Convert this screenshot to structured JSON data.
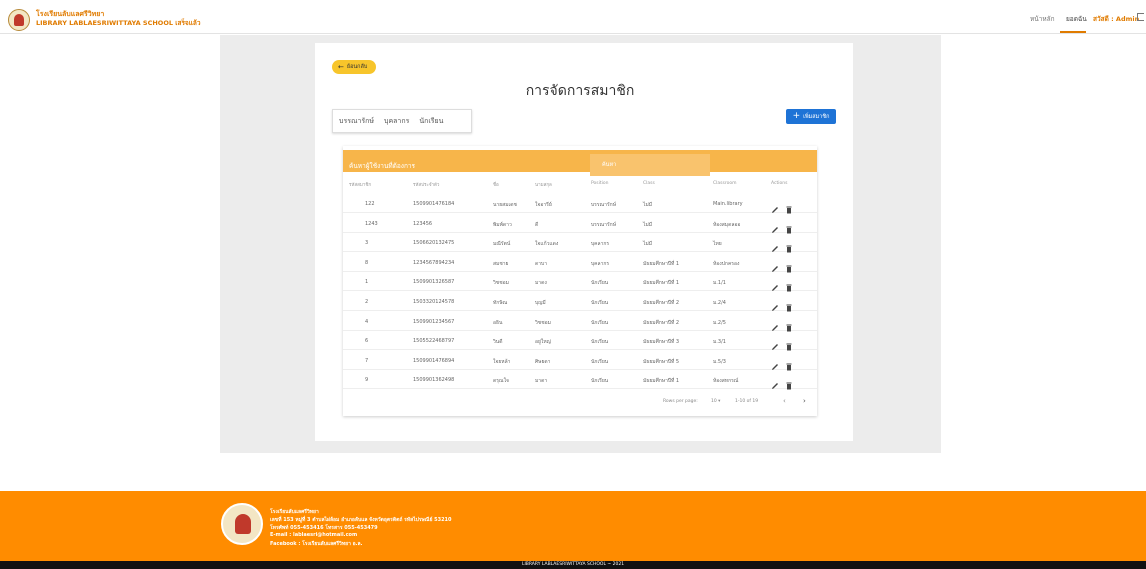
{
  "header": {
    "school_name": "โรงเรียนลับแลศรีวิทยา",
    "library_name": "LIBRARY LABLAESRIWITTAYA SCHOOL เสร็จแล้ว",
    "nav": [
      {
        "label": "หน้าหลัก"
      },
      {
        "label": "ยอดฉัน"
      },
      {
        "label": "สวัสดี : Admin"
      }
    ]
  },
  "page": {
    "back_label": "ย้อนกลับ",
    "title": "การจัดการสมาชิก",
    "tabs": [
      "บรรณารักษ์",
      "บุคลากร",
      "นักเรียน"
    ],
    "add_label": "เพิ่มสมาชิก"
  },
  "table": {
    "search_label": "ค้นหาผู้ใช้งานที่ต้องการ",
    "search_placeholder": "ค้นหา",
    "columns": [
      "รหัสสมาชิก",
      "รหัสประจำตัว",
      "ชื่อ",
      "นามสกุล",
      "Position",
      "Class",
      "Classroom",
      "Actions"
    ],
    "rows": [
      [
        "122",
        "1509901476184",
        "นายสมเดช",
        "ใจอารีย์",
        "บรรณารักษ์",
        "ไม่มี",
        "Main.library"
      ],
      [
        "1243",
        "123456",
        "พิมพ์ดาว",
        "ดี",
        "บรรณารักษ์",
        "ไม่มี",
        "ห้องสมุดลออ"
      ],
      [
        "3",
        "1506620132475",
        "มณีรัตน์",
        "ใจแก้วแดง",
        "บุคลากร",
        "ไม่มี",
        "ไทย"
      ],
      [
        "8",
        "1234567894234",
        "สมชาย",
        "ดาบา",
        "บุคลากร",
        "มัธยมศึกษาปีที่ 1",
        "ห้องปกครอง"
      ],
      [
        "1",
        "1509901326587",
        "วิชชอม",
        "มาดง",
        "นักเรียน",
        "มัธยมศึกษาปีที่ 1",
        "ม.1/1"
      ],
      [
        "2",
        "1503320124578",
        "ทักษิณ",
        "บุญมี",
        "นักเรียน",
        "มัธยมศึกษาปีที่ 2",
        "ม.2/4"
      ],
      [
        "4",
        "1509901234567",
        "อธิน",
        "วิชชอม",
        "นักเรียน",
        "มัธยมศึกษาปีที่ 2",
        "ม.2/5"
      ],
      [
        "6",
        "1505522468797",
        "วินดี",
        "อยู่ใหญ่",
        "นักเรียน",
        "มัธยมศึกษาปีที่ 3",
        "ม.3/1"
      ],
      [
        "7",
        "1509901476894",
        "ใจยหล้า",
        "ศิษยดา",
        "นักเรียน",
        "มัธยมศึกษาปีที่ 5",
        "ม.5/3"
      ],
      [
        "9",
        "1509901362498",
        "ดรุณใจ",
        "มาดา",
        "นักเรียน",
        "มัธยมศึกษาปีที่ 1",
        "ห้องสหกรณ์"
      ]
    ],
    "rows_per_page_label": "Rows per page:",
    "rows_per_page": "10",
    "range": "1-10 of 19"
  },
  "footer": {
    "lines": [
      "โรงเรียนลับแลศรีวิทยา",
      "เลขที่ 153 หมู่ที่ 3 ตำบลไผ่ล้อม อำเภอลับแล จังหวัดอุตรดิตถ์ รหัสไปรษณีย์ 53210",
      "โทรศัพท์ 055-453416 โทรสาร 055-453479",
      "E-mail : lablaesri@hotmail.com",
      "Facebook : โรงเรียนลับแลศรีวิทยา อ.ล."
    ],
    "copyright": "LIBRARY LABLAESRIWITTAYA SCHOOL ~ 2021"
  },
  "colors": {
    "accent": "#ff8c00",
    "header_bar": "#f7b54a",
    "add_button": "#1e73d6",
    "back_button": "#f7c52b"
  }
}
